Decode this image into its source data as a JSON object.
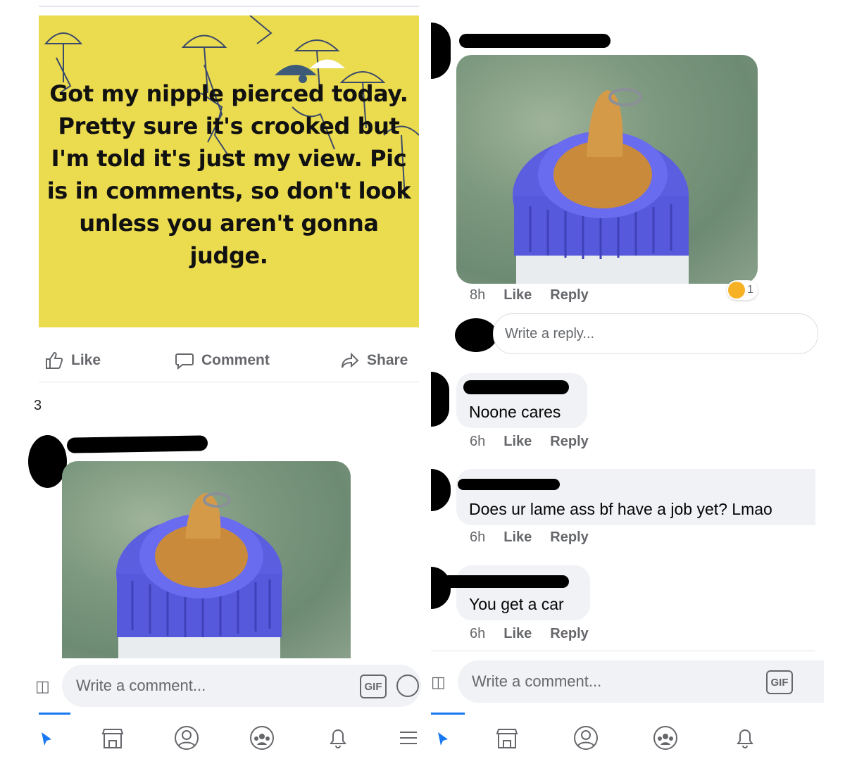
{
  "left": {
    "post_text": [
      "Got my nipple pierced today.",
      "Pretty sure it's crooked but",
      "I'm told it's just my view. Pic",
      "is in comments, so don't look",
      "unless you aren't gonna",
      "judge."
    ],
    "post_bg_color": "#ebdb4f",
    "actions": {
      "like": "Like",
      "comment": "Comment",
      "share": "Share"
    },
    "edge_count": "3",
    "comment_placeholder": "Write a comment...",
    "gif_label": "GIF"
  },
  "right": {
    "photo_comment_meta": {
      "time": "8h",
      "like": "Like",
      "reply": "Reply"
    },
    "reaction_count": "1",
    "reply_placeholder": "Write a reply...",
    "comments": [
      {
        "text": "Noone cares",
        "time": "6h",
        "like": "Like",
        "reply": "Reply"
      },
      {
        "text": "Does ur lame ass bf have a job yet? Lmao",
        "time": "6h",
        "like": "Like",
        "reply": "Reply"
      },
      {
        "text": "You get a car",
        "time": "6h",
        "like": "Like",
        "reply": "Reply"
      }
    ],
    "comment_placeholder": "Write a comment...",
    "gif_label": "GIF"
  },
  "nav_icons": [
    "home-icon",
    "marketplace-icon",
    "profile-icon",
    "groups-icon",
    "notifications-icon",
    "menu-icon"
  ],
  "accent_color": "#1877f2"
}
